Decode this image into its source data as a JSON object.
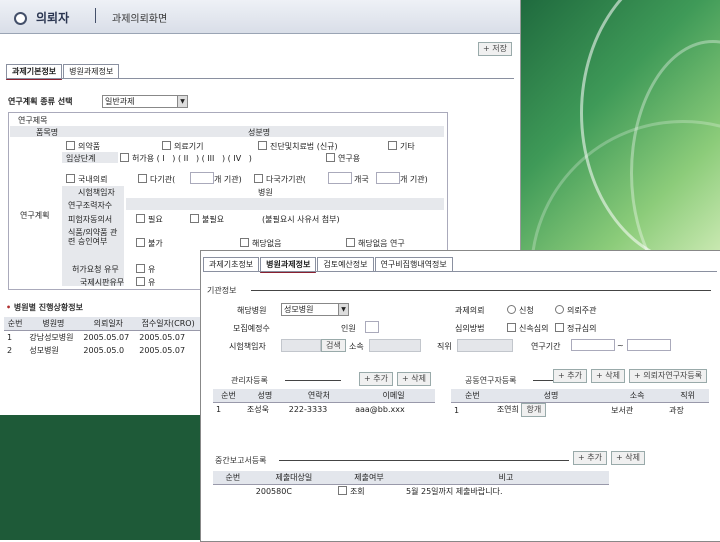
{
  "window1": {
    "header_title": "의뢰자",
    "header_subtitle": "과제의뢰화면",
    "top_button": "+ 저장",
    "tabs": [
      "과제기본정보",
      "병원과제정보"
    ],
    "research_type_label": "연구계획 종류 선택",
    "research_type_value": "일반과제",
    "section_research_title": "연구제목",
    "row_headers": [
      "품목명",
      "성분명"
    ],
    "checks_row1": [
      "의약품",
      "의료기기",
      "진단및치료법 (신규)",
      "기타"
    ],
    "check_label_clinical": "임상단계",
    "checks_row2": [
      "허가용",
      "연구용"
    ],
    "checks_row3": [
      "국내의뢰",
      "다기관(",
      "개 기관)",
      "다국가기관(",
      "개국",
      "개 기관)"
    ],
    "rows_left": [
      "시험책임자",
      "연구조력자수",
      "피험자동의서",
      "식품/의약품 관련 승인여부",
      "허가요청 유무",
      "국제시판유무"
    ],
    "row_hospital_label": "병원",
    "row_consent_opts": [
      "필요",
      "불필요",
      "(불필요시 사유서 첨부)"
    ],
    "row_approval_opts": [
      "불가",
      "해당없음",
      "해당없음 연구"
    ],
    "row_yes": [
      "유",
      "유"
    ],
    "section_plan": "연구계획",
    "status_title": "병원별 진행상황정보",
    "status_columns": [
      "순번",
      "병원명",
      "의뢰일자",
      "접수일자(CRO)"
    ],
    "status_rows": [
      [
        "1",
        "강남성모병원",
        "2005.05.07",
        "2005.05.07"
      ],
      [
        "2",
        "성모병원",
        "2005.05.0",
        "2005.05.07"
      ]
    ]
  },
  "window2": {
    "tabs": [
      "과제기초정보",
      "병원과제정보",
      "검토예산정보",
      "연구비집행내역정보"
    ],
    "basic_title": "기관정보",
    "hospital_label": "해당병원",
    "hospital_value": "성모병원",
    "review_label": "과제의뢰",
    "review_opts": [
      "신청",
      "의뢰주관"
    ],
    "irb_label": "심의방법",
    "irb_opts": [
      "신속심의",
      "정규심의"
    ],
    "drug_count_label": "모집예정수",
    "people_label": "인원",
    "responsible_label": "시험책임자",
    "search_button": "검색",
    "belong_label": "소속",
    "position_label": "직위",
    "period_label": "연구기간",
    "period_sep": "~",
    "manager_title": "관리자등록",
    "manager_buttons": [
      "+ 추가",
      "+ 삭제"
    ],
    "manager_columns": [
      "순번",
      "성명",
      "연락처",
      "이메일"
    ],
    "manager_rows": [
      [
        "1",
        "조성욱",
        "222-3333",
        "aaa@bb.xxx"
      ]
    ],
    "coresearch_title": "공동연구자등록",
    "coresearch_buttons": [
      "+ 추가",
      "+ 삭제",
      "+ 의뢰자연구자등록"
    ],
    "coresearch_columns": [
      "순번",
      "성명",
      "소속",
      "직위"
    ],
    "coresearch_rows": [
      [
        "1",
        "조연희",
        "항개",
        "보서관",
        "과장"
      ]
    ],
    "report_title": "중간보고서등록",
    "report_buttons": [
      "+ 추가",
      "+ 삭제"
    ],
    "report_columns": [
      "순번",
      "제출대상일",
      "제출여부",
      "비고"
    ],
    "report_rows": [
      [
        "",
        "200580C",
        "조회",
        "5월 25일까지 제출바랍니다."
      ]
    ]
  }
}
